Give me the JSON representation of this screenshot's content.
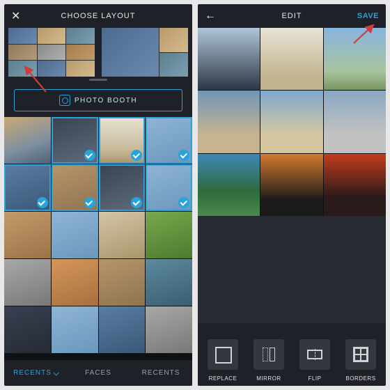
{
  "colors": {
    "accent": "#2aa3d8",
    "bg_dark": "#1e2228"
  },
  "left": {
    "title": "CHOOSE LAYOUT",
    "close_label": "✕",
    "photo_booth_label": "PHOTO BOOTH",
    "tabs": {
      "recents_active": "RECENTS",
      "faces": "FACES",
      "recents_2": "RECENTS"
    }
  },
  "right": {
    "title": "EDIT",
    "back_label": "←",
    "save_label": "SAVE",
    "tools": {
      "replace": "REPLACE",
      "mirror": "MIRROR",
      "flip": "FLIP",
      "borders": "BORDERS"
    }
  }
}
